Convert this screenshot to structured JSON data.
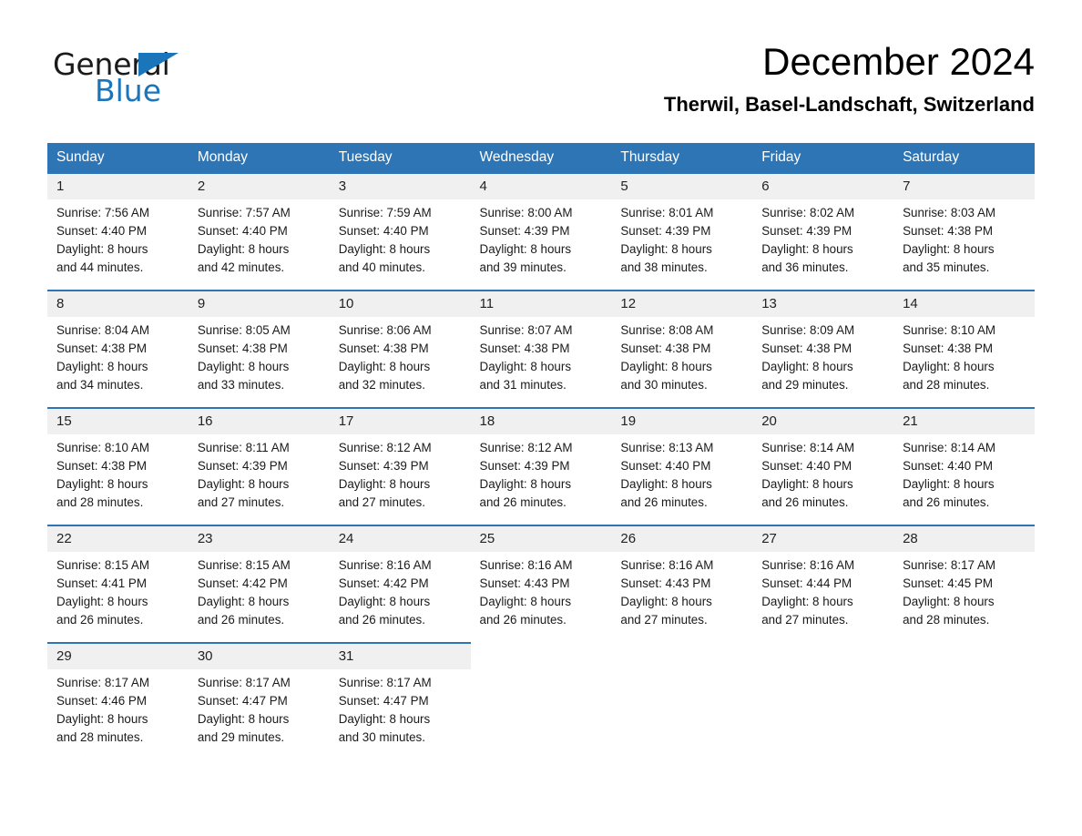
{
  "brand": {
    "name_part1": "General",
    "name_part2": "Blue",
    "triangle_color": "#1b75bb"
  },
  "header": {
    "title": "December 2024",
    "subtitle": "Therwil, Basel-Landschaft, Switzerland"
  },
  "colors": {
    "header_blue": "#2e75b6",
    "daynum_band": "#f0f0f0",
    "separator": "#2e75b6",
    "text": "#000000"
  },
  "weekdays": [
    "Sunday",
    "Monday",
    "Tuesday",
    "Wednesday",
    "Thursday",
    "Friday",
    "Saturday"
  ],
  "weeks": [
    {
      "days": [
        {
          "num": "1",
          "sunrise": "Sunrise: 7:56 AM",
          "sunset": "Sunset: 4:40 PM",
          "daylight1": "Daylight: 8 hours",
          "daylight2": "and 44 minutes."
        },
        {
          "num": "2",
          "sunrise": "Sunrise: 7:57 AM",
          "sunset": "Sunset: 4:40 PM",
          "daylight1": "Daylight: 8 hours",
          "daylight2": "and 42 minutes."
        },
        {
          "num": "3",
          "sunrise": "Sunrise: 7:59 AM",
          "sunset": "Sunset: 4:40 PM",
          "daylight1": "Daylight: 8 hours",
          "daylight2": "and 40 minutes."
        },
        {
          "num": "4",
          "sunrise": "Sunrise: 8:00 AM",
          "sunset": "Sunset: 4:39 PM",
          "daylight1": "Daylight: 8 hours",
          "daylight2": "and 39 minutes."
        },
        {
          "num": "5",
          "sunrise": "Sunrise: 8:01 AM",
          "sunset": "Sunset: 4:39 PM",
          "daylight1": "Daylight: 8 hours",
          "daylight2": "and 38 minutes."
        },
        {
          "num": "6",
          "sunrise": "Sunrise: 8:02 AM",
          "sunset": "Sunset: 4:39 PM",
          "daylight1": "Daylight: 8 hours",
          "daylight2": "and 36 minutes."
        },
        {
          "num": "7",
          "sunrise": "Sunrise: 8:03 AM",
          "sunset": "Sunset: 4:38 PM",
          "daylight1": "Daylight: 8 hours",
          "daylight2": "and 35 minutes."
        }
      ]
    },
    {
      "days": [
        {
          "num": "8",
          "sunrise": "Sunrise: 8:04 AM",
          "sunset": "Sunset: 4:38 PM",
          "daylight1": "Daylight: 8 hours",
          "daylight2": "and 34 minutes."
        },
        {
          "num": "9",
          "sunrise": "Sunrise: 8:05 AM",
          "sunset": "Sunset: 4:38 PM",
          "daylight1": "Daylight: 8 hours",
          "daylight2": "and 33 minutes."
        },
        {
          "num": "10",
          "sunrise": "Sunrise: 8:06 AM",
          "sunset": "Sunset: 4:38 PM",
          "daylight1": "Daylight: 8 hours",
          "daylight2": "and 32 minutes."
        },
        {
          "num": "11",
          "sunrise": "Sunrise: 8:07 AM",
          "sunset": "Sunset: 4:38 PM",
          "daylight1": "Daylight: 8 hours",
          "daylight2": "and 31 minutes."
        },
        {
          "num": "12",
          "sunrise": "Sunrise: 8:08 AM",
          "sunset": "Sunset: 4:38 PM",
          "daylight1": "Daylight: 8 hours",
          "daylight2": "and 30 minutes."
        },
        {
          "num": "13",
          "sunrise": "Sunrise: 8:09 AM",
          "sunset": "Sunset: 4:38 PM",
          "daylight1": "Daylight: 8 hours",
          "daylight2": "and 29 minutes."
        },
        {
          "num": "14",
          "sunrise": "Sunrise: 8:10 AM",
          "sunset": "Sunset: 4:38 PM",
          "daylight1": "Daylight: 8 hours",
          "daylight2": "and 28 minutes."
        }
      ]
    },
    {
      "days": [
        {
          "num": "15",
          "sunrise": "Sunrise: 8:10 AM",
          "sunset": "Sunset: 4:38 PM",
          "daylight1": "Daylight: 8 hours",
          "daylight2": "and 28 minutes."
        },
        {
          "num": "16",
          "sunrise": "Sunrise: 8:11 AM",
          "sunset": "Sunset: 4:39 PM",
          "daylight1": "Daylight: 8 hours",
          "daylight2": "and 27 minutes."
        },
        {
          "num": "17",
          "sunrise": "Sunrise: 8:12 AM",
          "sunset": "Sunset: 4:39 PM",
          "daylight1": "Daylight: 8 hours",
          "daylight2": "and 27 minutes."
        },
        {
          "num": "18",
          "sunrise": "Sunrise: 8:12 AM",
          "sunset": "Sunset: 4:39 PM",
          "daylight1": "Daylight: 8 hours",
          "daylight2": "and 26 minutes."
        },
        {
          "num": "19",
          "sunrise": "Sunrise: 8:13 AM",
          "sunset": "Sunset: 4:40 PM",
          "daylight1": "Daylight: 8 hours",
          "daylight2": "and 26 minutes."
        },
        {
          "num": "20",
          "sunrise": "Sunrise: 8:14 AM",
          "sunset": "Sunset: 4:40 PM",
          "daylight1": "Daylight: 8 hours",
          "daylight2": "and 26 minutes."
        },
        {
          "num": "21",
          "sunrise": "Sunrise: 8:14 AM",
          "sunset": "Sunset: 4:40 PM",
          "daylight1": "Daylight: 8 hours",
          "daylight2": "and 26 minutes."
        }
      ]
    },
    {
      "days": [
        {
          "num": "22",
          "sunrise": "Sunrise: 8:15 AM",
          "sunset": "Sunset: 4:41 PM",
          "daylight1": "Daylight: 8 hours",
          "daylight2": "and 26 minutes."
        },
        {
          "num": "23",
          "sunrise": "Sunrise: 8:15 AM",
          "sunset": "Sunset: 4:42 PM",
          "daylight1": "Daylight: 8 hours",
          "daylight2": "and 26 minutes."
        },
        {
          "num": "24",
          "sunrise": "Sunrise: 8:16 AM",
          "sunset": "Sunset: 4:42 PM",
          "daylight1": "Daylight: 8 hours",
          "daylight2": "and 26 minutes."
        },
        {
          "num": "25",
          "sunrise": "Sunrise: 8:16 AM",
          "sunset": "Sunset: 4:43 PM",
          "daylight1": "Daylight: 8 hours",
          "daylight2": "and 26 minutes."
        },
        {
          "num": "26",
          "sunrise": "Sunrise: 8:16 AM",
          "sunset": "Sunset: 4:43 PM",
          "daylight1": "Daylight: 8 hours",
          "daylight2": "and 27 minutes."
        },
        {
          "num": "27",
          "sunrise": "Sunrise: 8:16 AM",
          "sunset": "Sunset: 4:44 PM",
          "daylight1": "Daylight: 8 hours",
          "daylight2": "and 27 minutes."
        },
        {
          "num": "28",
          "sunrise": "Sunrise: 8:17 AM",
          "sunset": "Sunset: 4:45 PM",
          "daylight1": "Daylight: 8 hours",
          "daylight2": "and 28 minutes."
        }
      ]
    },
    {
      "days": [
        {
          "num": "29",
          "sunrise": "Sunrise: 8:17 AM",
          "sunset": "Sunset: 4:46 PM",
          "daylight1": "Daylight: 8 hours",
          "daylight2": "and 28 minutes."
        },
        {
          "num": "30",
          "sunrise": "Sunrise: 8:17 AM",
          "sunset": "Sunset: 4:47 PM",
          "daylight1": "Daylight: 8 hours",
          "daylight2": "and 29 minutes."
        },
        {
          "num": "31",
          "sunrise": "Sunrise: 8:17 AM",
          "sunset": "Sunset: 4:47 PM",
          "daylight1": "Daylight: 8 hours",
          "daylight2": "and 30 minutes."
        },
        {
          "num": "",
          "sunrise": "",
          "sunset": "",
          "daylight1": "",
          "daylight2": ""
        },
        {
          "num": "",
          "sunrise": "",
          "sunset": "",
          "daylight1": "",
          "daylight2": ""
        },
        {
          "num": "",
          "sunrise": "",
          "sunset": "",
          "daylight1": "",
          "daylight2": ""
        },
        {
          "num": "",
          "sunrise": "",
          "sunset": "",
          "daylight1": "",
          "daylight2": ""
        }
      ]
    }
  ]
}
